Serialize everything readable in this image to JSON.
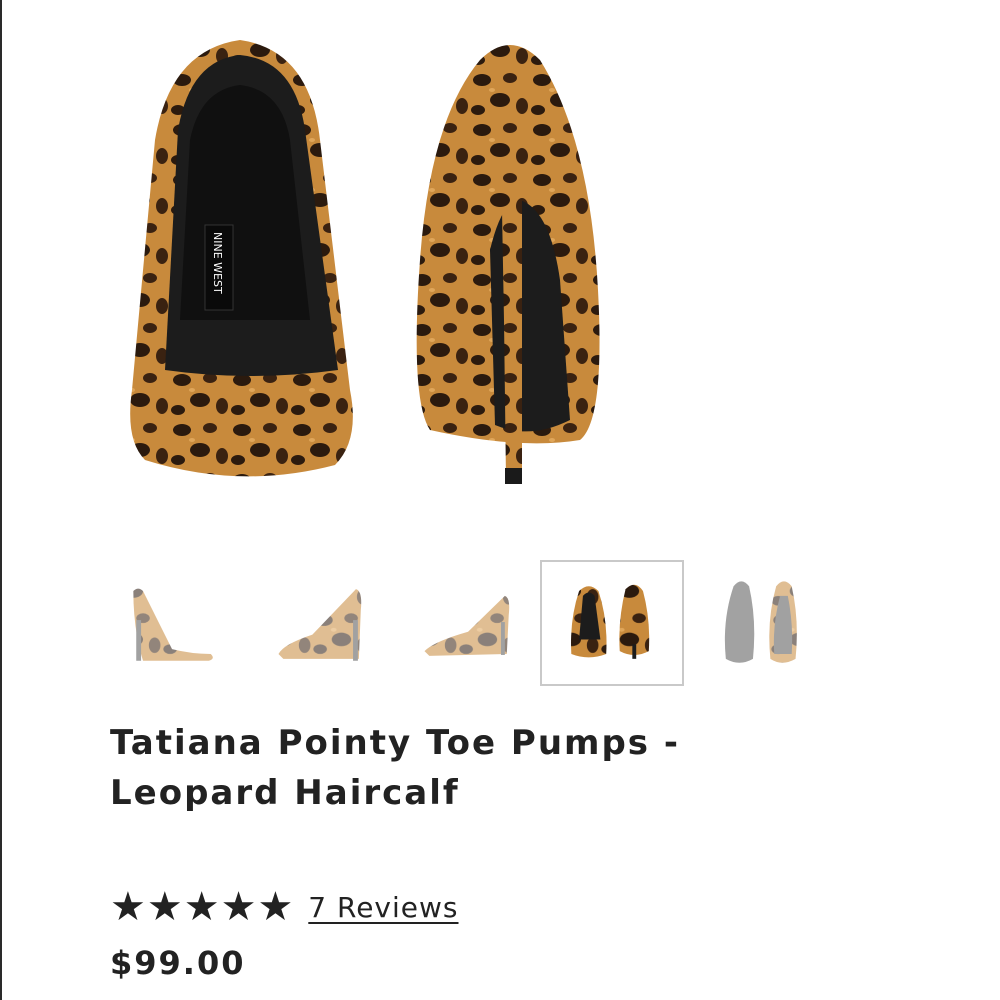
{
  "product": {
    "brand_tag": "NINE WEST",
    "title_line1": "Tatiana Pointy Toe Pumps -",
    "title_line2": "Leopard Haircalf",
    "rating": {
      "value": 5,
      "max": 5,
      "reviews_label": "7 Reviews"
    },
    "price": "$99.00"
  },
  "gallery": {
    "selected_index": 3,
    "thumbnails": [
      {
        "view": "side-left"
      },
      {
        "view": "side-right"
      },
      {
        "view": "side-right-low"
      },
      {
        "view": "front-back-pair"
      },
      {
        "view": "sole-pair"
      }
    ]
  },
  "colors": {
    "leopard_base": "#c88a3c",
    "leopard_spot": "#2b1a0e",
    "lining": "#1c1c1c",
    "text": "#222222"
  }
}
